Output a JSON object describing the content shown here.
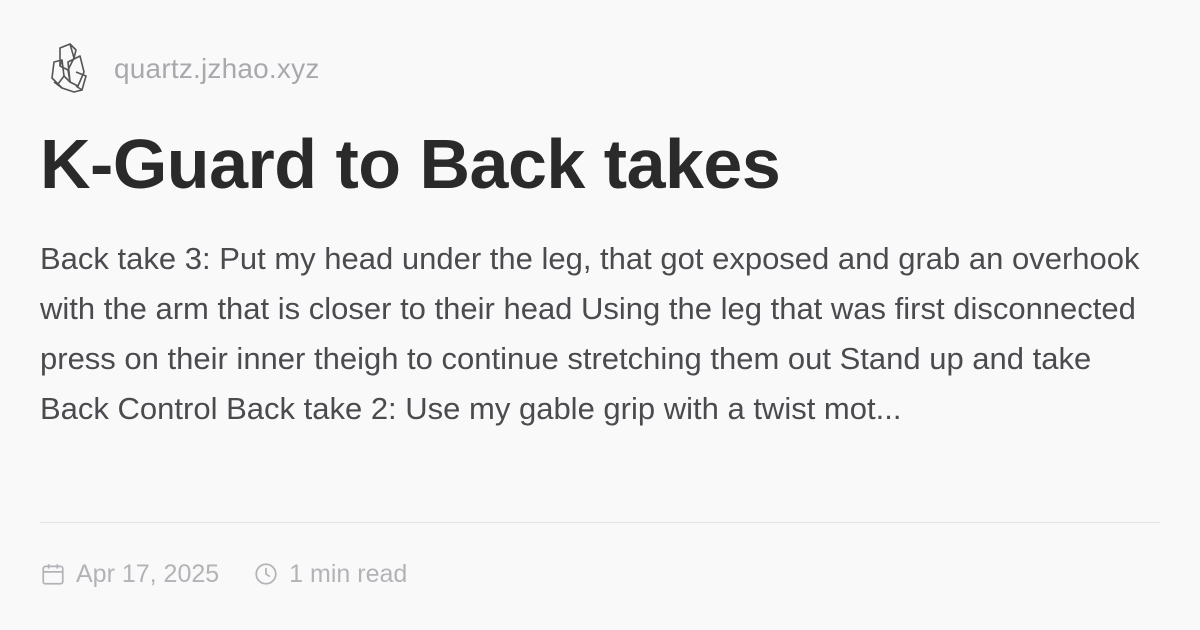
{
  "site": {
    "name": "quartz.jzhao.xyz",
    "logo_icon": "crystal-cluster-logo"
  },
  "page": {
    "title": "K-Guard to Back takes",
    "excerpt": "Back take 3: Put my head under the leg, that got exposed and grab an overhook with the arm that is closer to their head Using the leg that was first disconnected press on their inner theigh to continue stretching them out Stand up and take Back Control Back take 2: Use my gable grip with a twist mot..."
  },
  "meta": {
    "date": "Apr 17, 2025",
    "reading_time": "1 min read",
    "date_icon": "calendar-icon",
    "time_icon": "clock-icon"
  },
  "colors": {
    "background": "#faf9fa",
    "title": "#2a2a2a",
    "excerpt": "#4b4b4f",
    "muted": "#b3b2b6",
    "divider": "#e5e3e6"
  }
}
